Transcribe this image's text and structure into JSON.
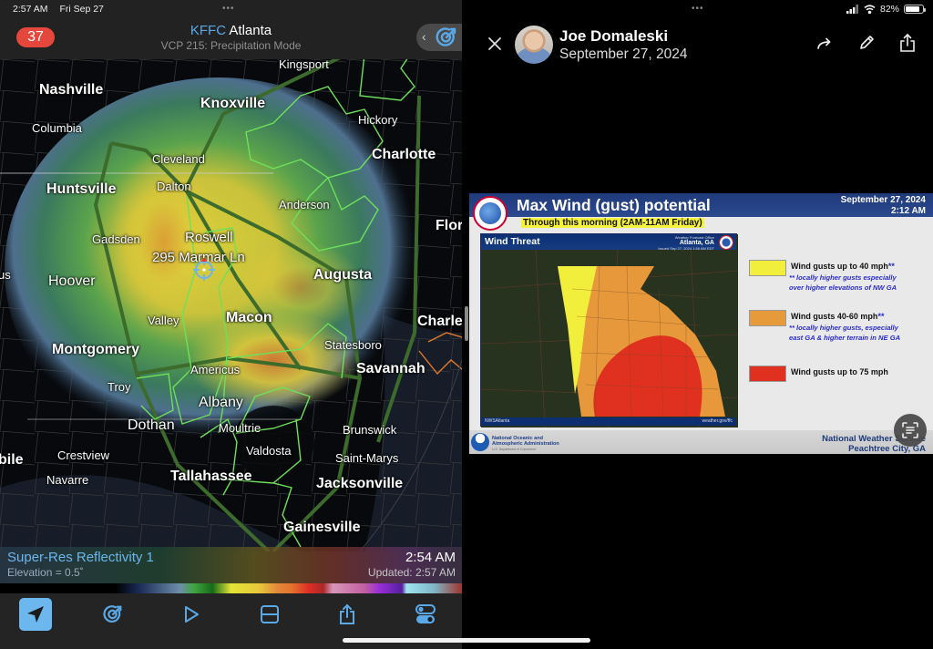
{
  "status_bar": {
    "time": "2:57 AM",
    "date": "Fri Sep 27",
    "battery_percent": "82%",
    "battery_level": 0.82,
    "multitask_dots": "•••"
  },
  "radar_app": {
    "alert_count": "37",
    "station_code": "KFFC",
    "station_name": "Atlanta",
    "scan_mode": "VCP 215: Precipitation Mode",
    "collapse_chevron": "‹",
    "location_label": "295 Marmar Ln",
    "map_labels": [
      {
        "name": "Kingsport",
        "size": "med"
      },
      {
        "name": "Nashville",
        "size": "big"
      },
      {
        "name": "Knoxville",
        "size": "big"
      },
      {
        "name": "Hickory",
        "size": "med"
      },
      {
        "name": "Columbia",
        "size": "med"
      },
      {
        "name": "Charlotte",
        "size": "big"
      },
      {
        "name": "Cleveland",
        "size": "med"
      },
      {
        "name": "Huntsville",
        "size": "big"
      },
      {
        "name": "Dalton",
        "size": "med"
      },
      {
        "name": "Anderson",
        "size": "med"
      },
      {
        "name": "Flor",
        "size": "big"
      },
      {
        "name": "Gadsden",
        "size": "med"
      },
      {
        "name": "Roswell",
        "size": "med"
      },
      {
        "name": "us",
        "size": "med"
      },
      {
        "name": "Hoover",
        "size": "big"
      },
      {
        "name": "Augusta",
        "size": "big"
      },
      {
        "name": "Valley",
        "size": "med"
      },
      {
        "name": "Macon",
        "size": "big"
      },
      {
        "name": "Charle",
        "size": "big"
      },
      {
        "name": "Montgomery",
        "size": "big"
      },
      {
        "name": "Statesboro",
        "size": "med"
      },
      {
        "name": "Americus",
        "size": "med"
      },
      {
        "name": "Savannah",
        "size": "big"
      },
      {
        "name": "Troy",
        "size": "med"
      },
      {
        "name": "Albany",
        "size": "big"
      },
      {
        "name": "Dothan",
        "size": "big"
      },
      {
        "name": "Moultrie",
        "size": "med"
      },
      {
        "name": "Brunswick",
        "size": "med"
      },
      {
        "name": "Valdosta",
        "size": "med"
      },
      {
        "name": "bile",
        "size": "big"
      },
      {
        "name": "Crestview",
        "size": "med"
      },
      {
        "name": "Saint-Marys",
        "size": "med"
      },
      {
        "name": "Navarre",
        "size": "med"
      },
      {
        "name": "Tallahassee",
        "size": "big"
      },
      {
        "name": "Jacksonville",
        "size": "big"
      },
      {
        "name": "Gainesville",
        "size": "big"
      }
    ],
    "product": {
      "name": "Super-Res Reflectivity 1",
      "elevation": "Elevation = 0.5˚",
      "scan_time": "2:54 AM",
      "updated": "Updated: 2:57 AM"
    },
    "toolbar": [
      {
        "id": "location",
        "icon": "location-arrow-icon",
        "active": true
      },
      {
        "id": "radar",
        "icon": "radar-icon",
        "active": false
      },
      {
        "id": "play",
        "icon": "play-icon",
        "active": false
      },
      {
        "id": "layout",
        "icon": "split-layout-icon",
        "active": false
      },
      {
        "id": "share",
        "icon": "share-icon",
        "active": false
      },
      {
        "id": "settings",
        "icon": "toggles-icon",
        "active": false
      }
    ]
  },
  "viewer": {
    "author": "Joe Domaleski",
    "date": "September 27, 2024",
    "actions": [
      "close",
      "forward",
      "edit",
      "share"
    ]
  },
  "graphic": {
    "title": "Max Wind (gust) potential",
    "date": "September 27, 2024",
    "time": "2:12 AM",
    "subtitle": "Through this morning (2AM-11AM Friday)",
    "map_title": "Wind Threat",
    "office_caption": "Weather Forecast Office",
    "office": "Atlanta, GA",
    "issued": "Issued Sep 27, 2024 1:56 AM EDT",
    "social": "NWSAtlanta",
    "website": "weather.gov/ffc",
    "legend": [
      {
        "label": "Wind gusts up to 40 mph",
        "suffix": "**",
        "color": "#f2ee3c",
        "note1": "** locally higher gusts especially",
        "note2": "over higher elevations of NW GA"
      },
      {
        "label": "Wind gusts 40-60 mph",
        "suffix": "**",
        "color": "#e69a3a",
        "note1": "** locally higher gusts, especially",
        "note2": "east GA & higher terrain in NE GA"
      },
      {
        "label": "Wind gusts up to 75 mph",
        "suffix": "",
        "color": "#e0301f",
        "note1": "",
        "note2": ""
      }
    ],
    "noaa_line1": "National Oceanic and",
    "noaa_line2": "Atmospheric Administration",
    "noaa_line3": "U.S. Department of Commerce",
    "nws_line1": "National Weather Service",
    "nws_line2": "Peachtree City, GA"
  },
  "colors": {
    "accent_blue": "#5aa9e6",
    "alert_red": "#e5473d",
    "county_outline_green": "#6ee05a",
    "nws_blue": "#1f3a7a"
  }
}
